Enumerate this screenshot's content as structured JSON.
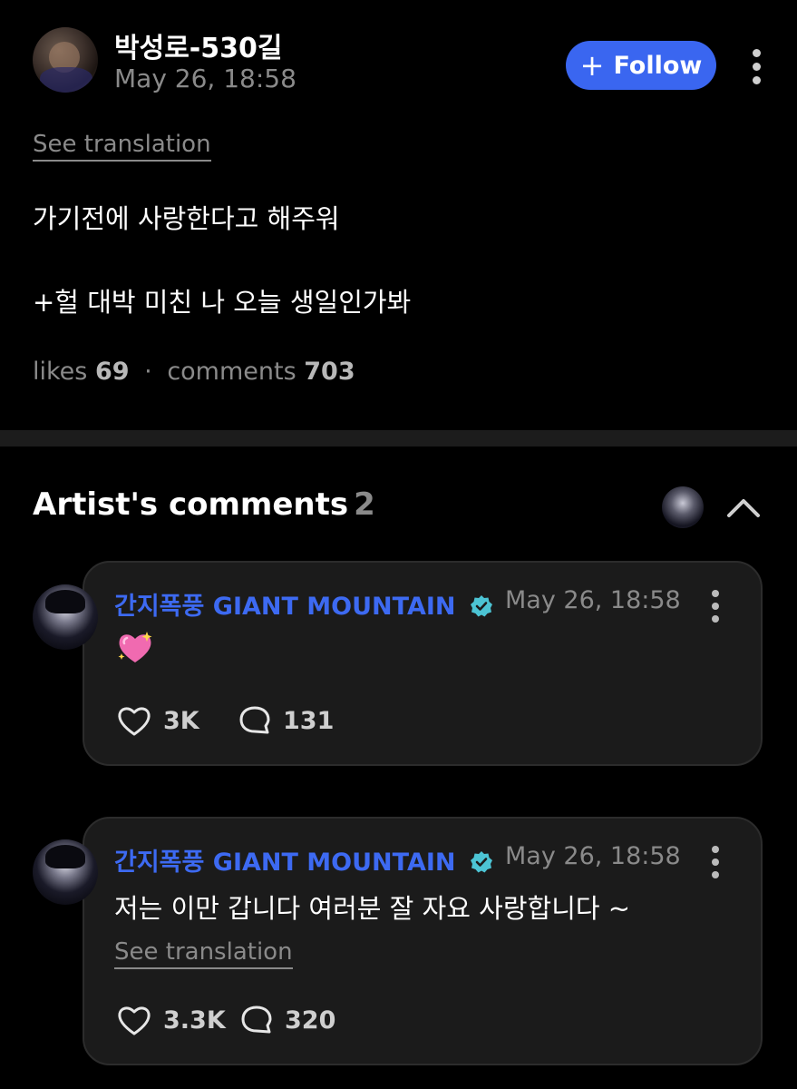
{
  "post": {
    "author": "박성로-530길",
    "time": "May 26, 18:58",
    "follow_label": "Follow",
    "see_translation": "See translation",
    "text_line1": "가기전에 사랑한다고 해주워",
    "text_line2": "+헐 대박 미친 나 오늘 생일인가봐",
    "likes_label": "likes",
    "likes_count": "69",
    "separator": "·",
    "comments_label": "comments",
    "comments_count": "703"
  },
  "artist_comments": {
    "title": "Artist's comments",
    "count": "2",
    "items": [
      {
        "author_ko": "간지폭풍",
        "author_en": "GIANT MOUNTAIN",
        "time": "May 26, 18:58",
        "emoji": "sparkling-heart",
        "likes": "3K",
        "replies": "131"
      },
      {
        "author_ko": "간지폭풍",
        "author_en": "GIANT MOUNTAIN",
        "time": "May 26, 18:58",
        "text": "저는 이만 갑니다 여러분 잘 자요 사랑합니다 ~",
        "see_translation": "See translation",
        "likes": "3.3K",
        "replies": "320"
      }
    ]
  },
  "colors": {
    "background": "#000000",
    "follow_button": "#3a66f0",
    "artist_name": "#3d6af2",
    "verified_badge": "#4cc4d4",
    "muted_text": "#8a8a8a",
    "card_background": "#1b1b1b",
    "emoji_heart": "#f06ab0"
  },
  "icons": [
    "plus-icon",
    "more-vertical-icon",
    "chevron-up-icon",
    "verified-badge-icon",
    "sparkling-heart-emoji",
    "heart-icon",
    "comment-bubble-icon"
  ]
}
